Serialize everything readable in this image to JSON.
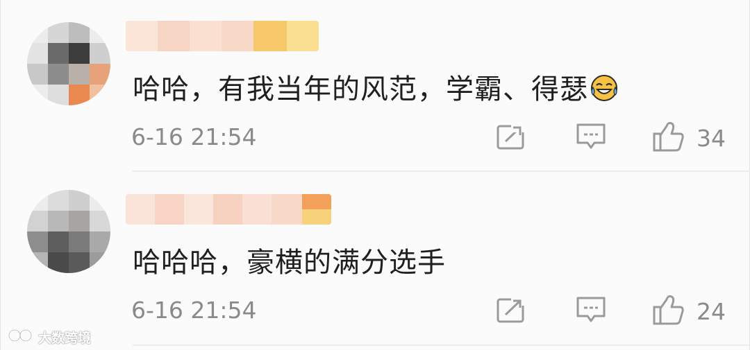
{
  "comments": [
    {
      "text": "哈哈，有我当年的风范，学霸、得瑟",
      "emoji": "laugh-cry-emoji",
      "time": "6-16 21:54",
      "likes": "34"
    },
    {
      "text": "哈哈哈，豪横的满分选手",
      "time": "6-16 21:54",
      "likes": "24"
    }
  ],
  "icons": {
    "share": "share-icon",
    "reply": "comment-icon",
    "like": "thumbs-up-icon"
  },
  "colors": {
    "text": "#1f1f1f",
    "meta": "#8a8a8a",
    "icon": "#9a9a9a",
    "divider": "#ececec"
  },
  "watermark": {
    "text": "大数跨境"
  }
}
